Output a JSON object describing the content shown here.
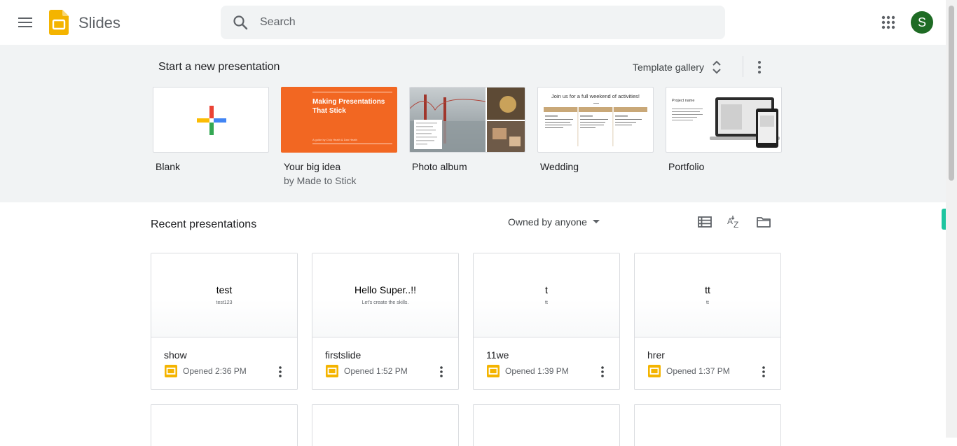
{
  "header": {
    "app_title": "Slides",
    "search_placeholder": "Search",
    "avatar_letter": "S"
  },
  "templates": {
    "section_title": "Start a new presentation",
    "gallery_label": "Template gallery",
    "items": [
      {
        "name": "Blank",
        "sub": ""
      },
      {
        "name": "Your big idea",
        "sub": "by Made to Stick",
        "thumb_title": "Making Presentations That Stick",
        "thumb_caption": "A guide by Chip Heath & Dan Heath"
      },
      {
        "name": "Photo album",
        "sub": ""
      },
      {
        "name": "Wedding",
        "sub": "",
        "thumb_title": "Join us for a full weekend of activities!"
      },
      {
        "name": "Portfolio",
        "sub": "",
        "thumb_title": "Project name"
      }
    ]
  },
  "recent": {
    "title": "Recent presentations",
    "owner_filter": "Owned by anyone",
    "cards": [
      {
        "preview_title": "test",
        "preview_sub": "test123",
        "name": "show",
        "opened": "Opened 2:36 PM"
      },
      {
        "preview_title": "Hello Super..!!",
        "preview_sub": "Let's create the skills.",
        "name": "firstslide",
        "opened": "Opened 1:52 PM"
      },
      {
        "preview_title": "t",
        "preview_sub": "tt",
        "name": "11we",
        "opened": "Opened 1:39 PM"
      },
      {
        "preview_title": "tt",
        "preview_sub": "tt",
        "name": "hrer",
        "opened": "Opened 1:37 PM"
      }
    ]
  },
  "colors": {
    "brand_yellow": "#f4b400",
    "avatar_green": "#1e6b24",
    "template_bg": "#f1f3f4",
    "orange": "#f26722"
  },
  "icons": [
    "menu-icon",
    "slides-logo",
    "search-icon",
    "apps-grid-icon",
    "unfold-icon",
    "more-vert-icon",
    "list-view-icon",
    "sort-az-icon",
    "folder-icon",
    "slides-file-icon"
  ]
}
